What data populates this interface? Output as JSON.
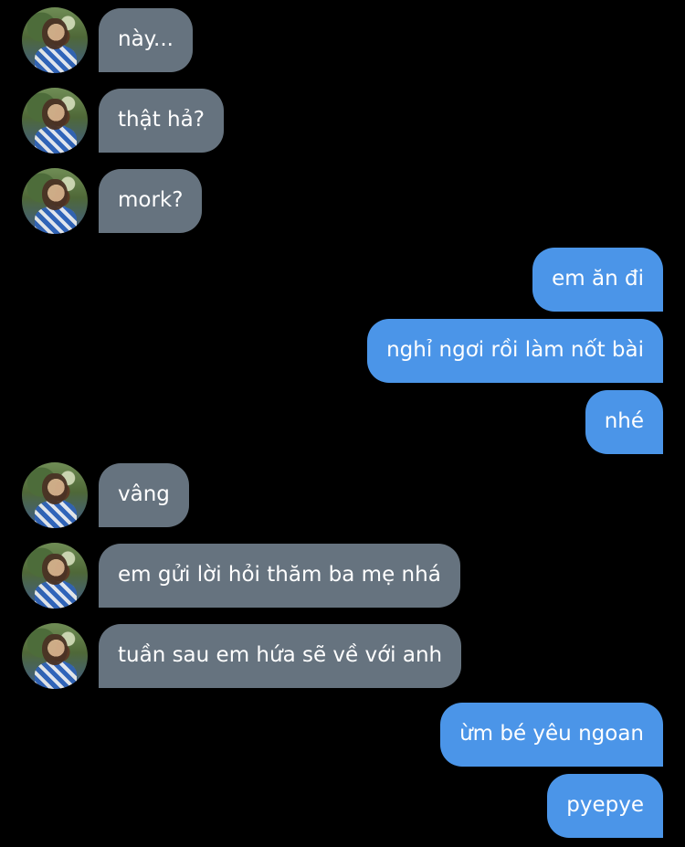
{
  "messages": [
    {
      "side": "in",
      "text": "này..."
    },
    {
      "side": "in",
      "text": "thật hả?"
    },
    {
      "side": "in",
      "text": "mork?"
    },
    {
      "side": "out",
      "text": "em ăn đi"
    },
    {
      "side": "out",
      "text": "nghỉ ngơi rồi làm nốt bài"
    },
    {
      "side": "out",
      "text": "nhé"
    },
    {
      "side": "in",
      "text": "vâng"
    },
    {
      "side": "in",
      "text": "em gửi lời hỏi thăm ba mẹ nhá"
    },
    {
      "side": "in",
      "text": "tuần sau em hứa sẽ về với anh"
    },
    {
      "side": "out",
      "text": "ừm bé yêu ngoan"
    },
    {
      "side": "out",
      "text": "pyepye"
    }
  ],
  "colors": {
    "background": "#000000",
    "incoming_bubble": "#66737f",
    "outgoing_bubble": "#4b95e8",
    "text": "#ffffff"
  },
  "icons": {
    "avatar": "contact-avatar-photo"
  }
}
